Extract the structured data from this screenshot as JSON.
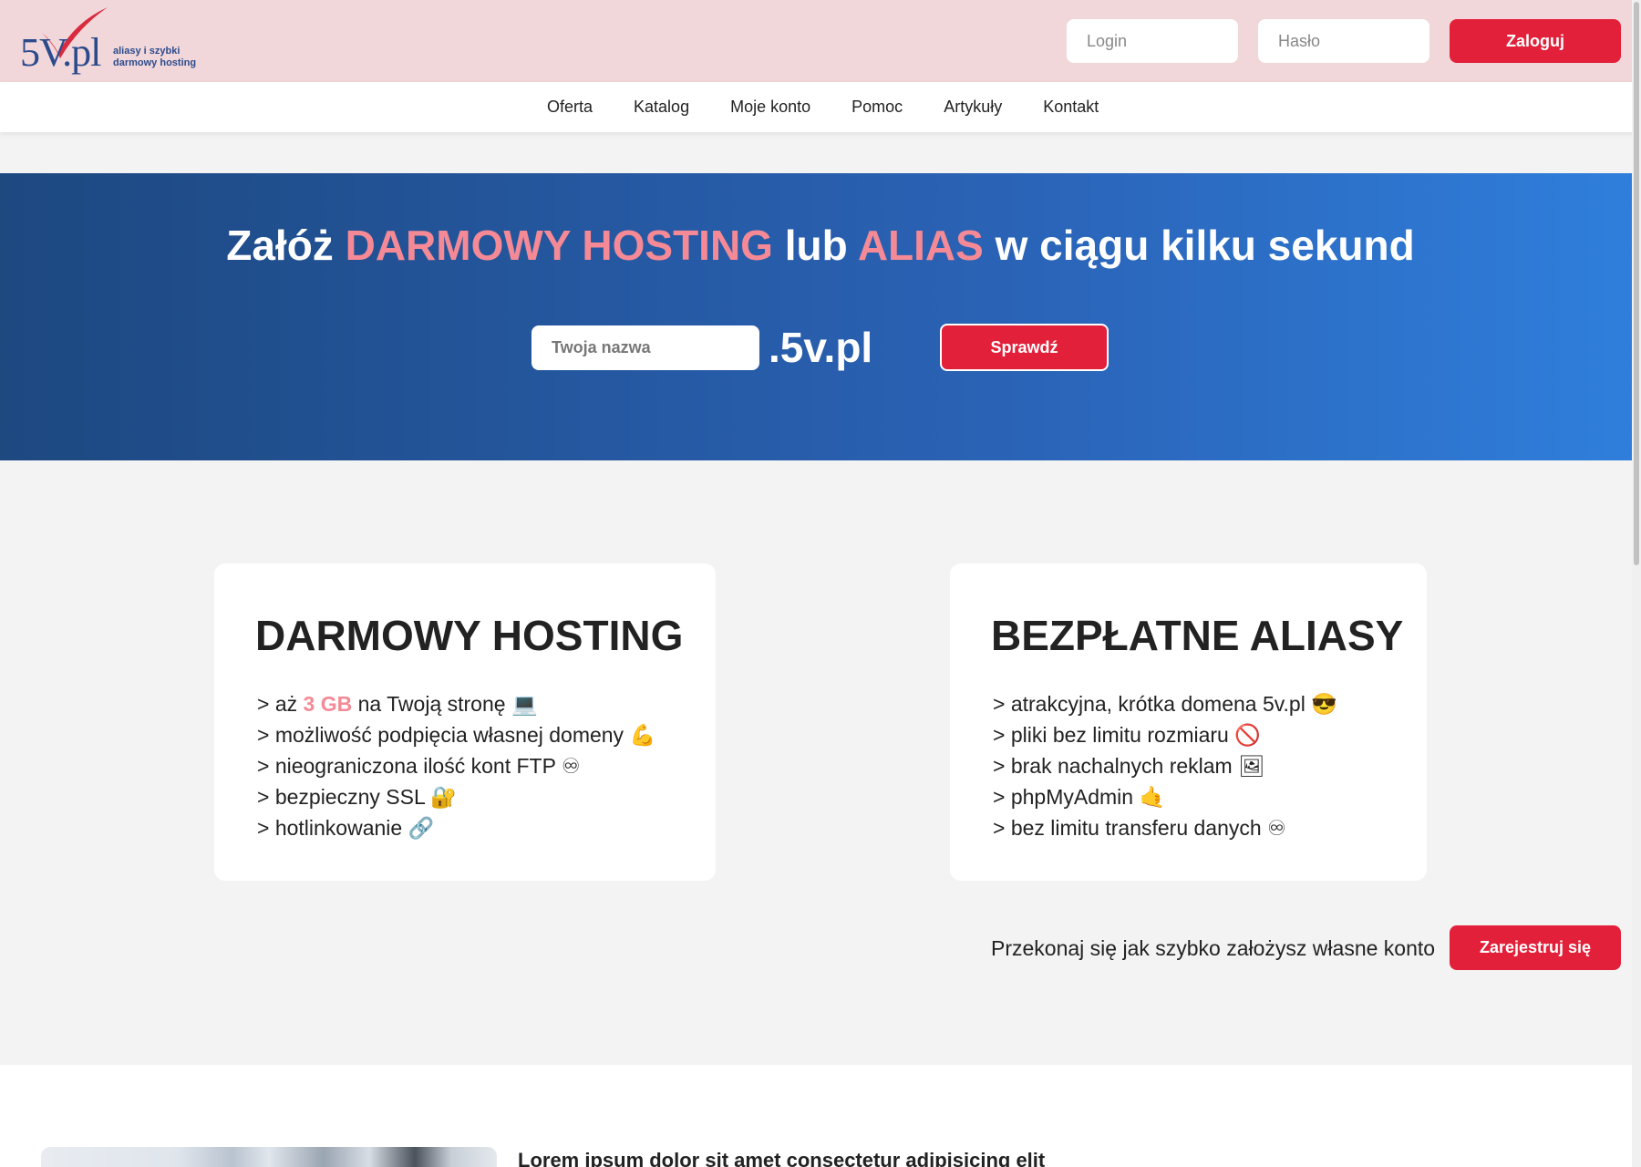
{
  "logo": {
    "main_text": "5V.pl",
    "tagline_1": "aliasy i szybki",
    "tagline_2": "darmowy hosting"
  },
  "login": {
    "login_placeholder": "Login",
    "password_placeholder": "Hasło",
    "button": "Zaloguj"
  },
  "nav": {
    "items": [
      "Oferta",
      "Katalog",
      "Moje konto",
      "Pomoc",
      "Artykuły",
      "Kontakt"
    ]
  },
  "hero": {
    "title_part1": "Załóż ",
    "title_hl1": "DARMOWY HOSTING",
    "title_part2": " lub ",
    "title_hl2": "ALIAS",
    "title_part3": " w ciągu kilku sekund",
    "name_placeholder": "Twoja nazwa",
    "domain_suffix": ".5v.pl",
    "check_button": "Sprawdź"
  },
  "hosting_card": {
    "title": "DARMOWY HOSTING",
    "item1_pre": "> aż ",
    "item1_hl": "3 GB",
    "item1_post": " na Twoją stronę 💻",
    "items": [
      "> możliwość podpięcia własnej domeny 💪",
      "> nieograniczona ilość kont FTP ♾",
      "> bezpieczny SSL 🔐",
      "> hotlinkowanie 🔗"
    ]
  },
  "alias_card": {
    "title": "BEZPŁATNE ALIASY",
    "items": [
      "> atrakcyjna, krótka domena 5v.pl 😎",
      "> pliki bez limitu rozmiaru 🚫",
      "> brak nachalnych reklam 🖼",
      "> phpMyAdmin 🤙",
      "> bez limitu transferu danych ♾"
    ]
  },
  "cta": {
    "text": "Przekonaj się jak szybko założysz własne konto",
    "button": "Zarejestruj się"
  },
  "lower": {
    "heading": "Lorem ipsum dolor sit amet consectetur adipisicing elit"
  },
  "colors": {
    "accent": "#e3203a",
    "highlight": "#f58a96",
    "topbar": "#f2d7da",
    "hero_start": "#1d4880",
    "hero_end": "#2f7fdc"
  }
}
